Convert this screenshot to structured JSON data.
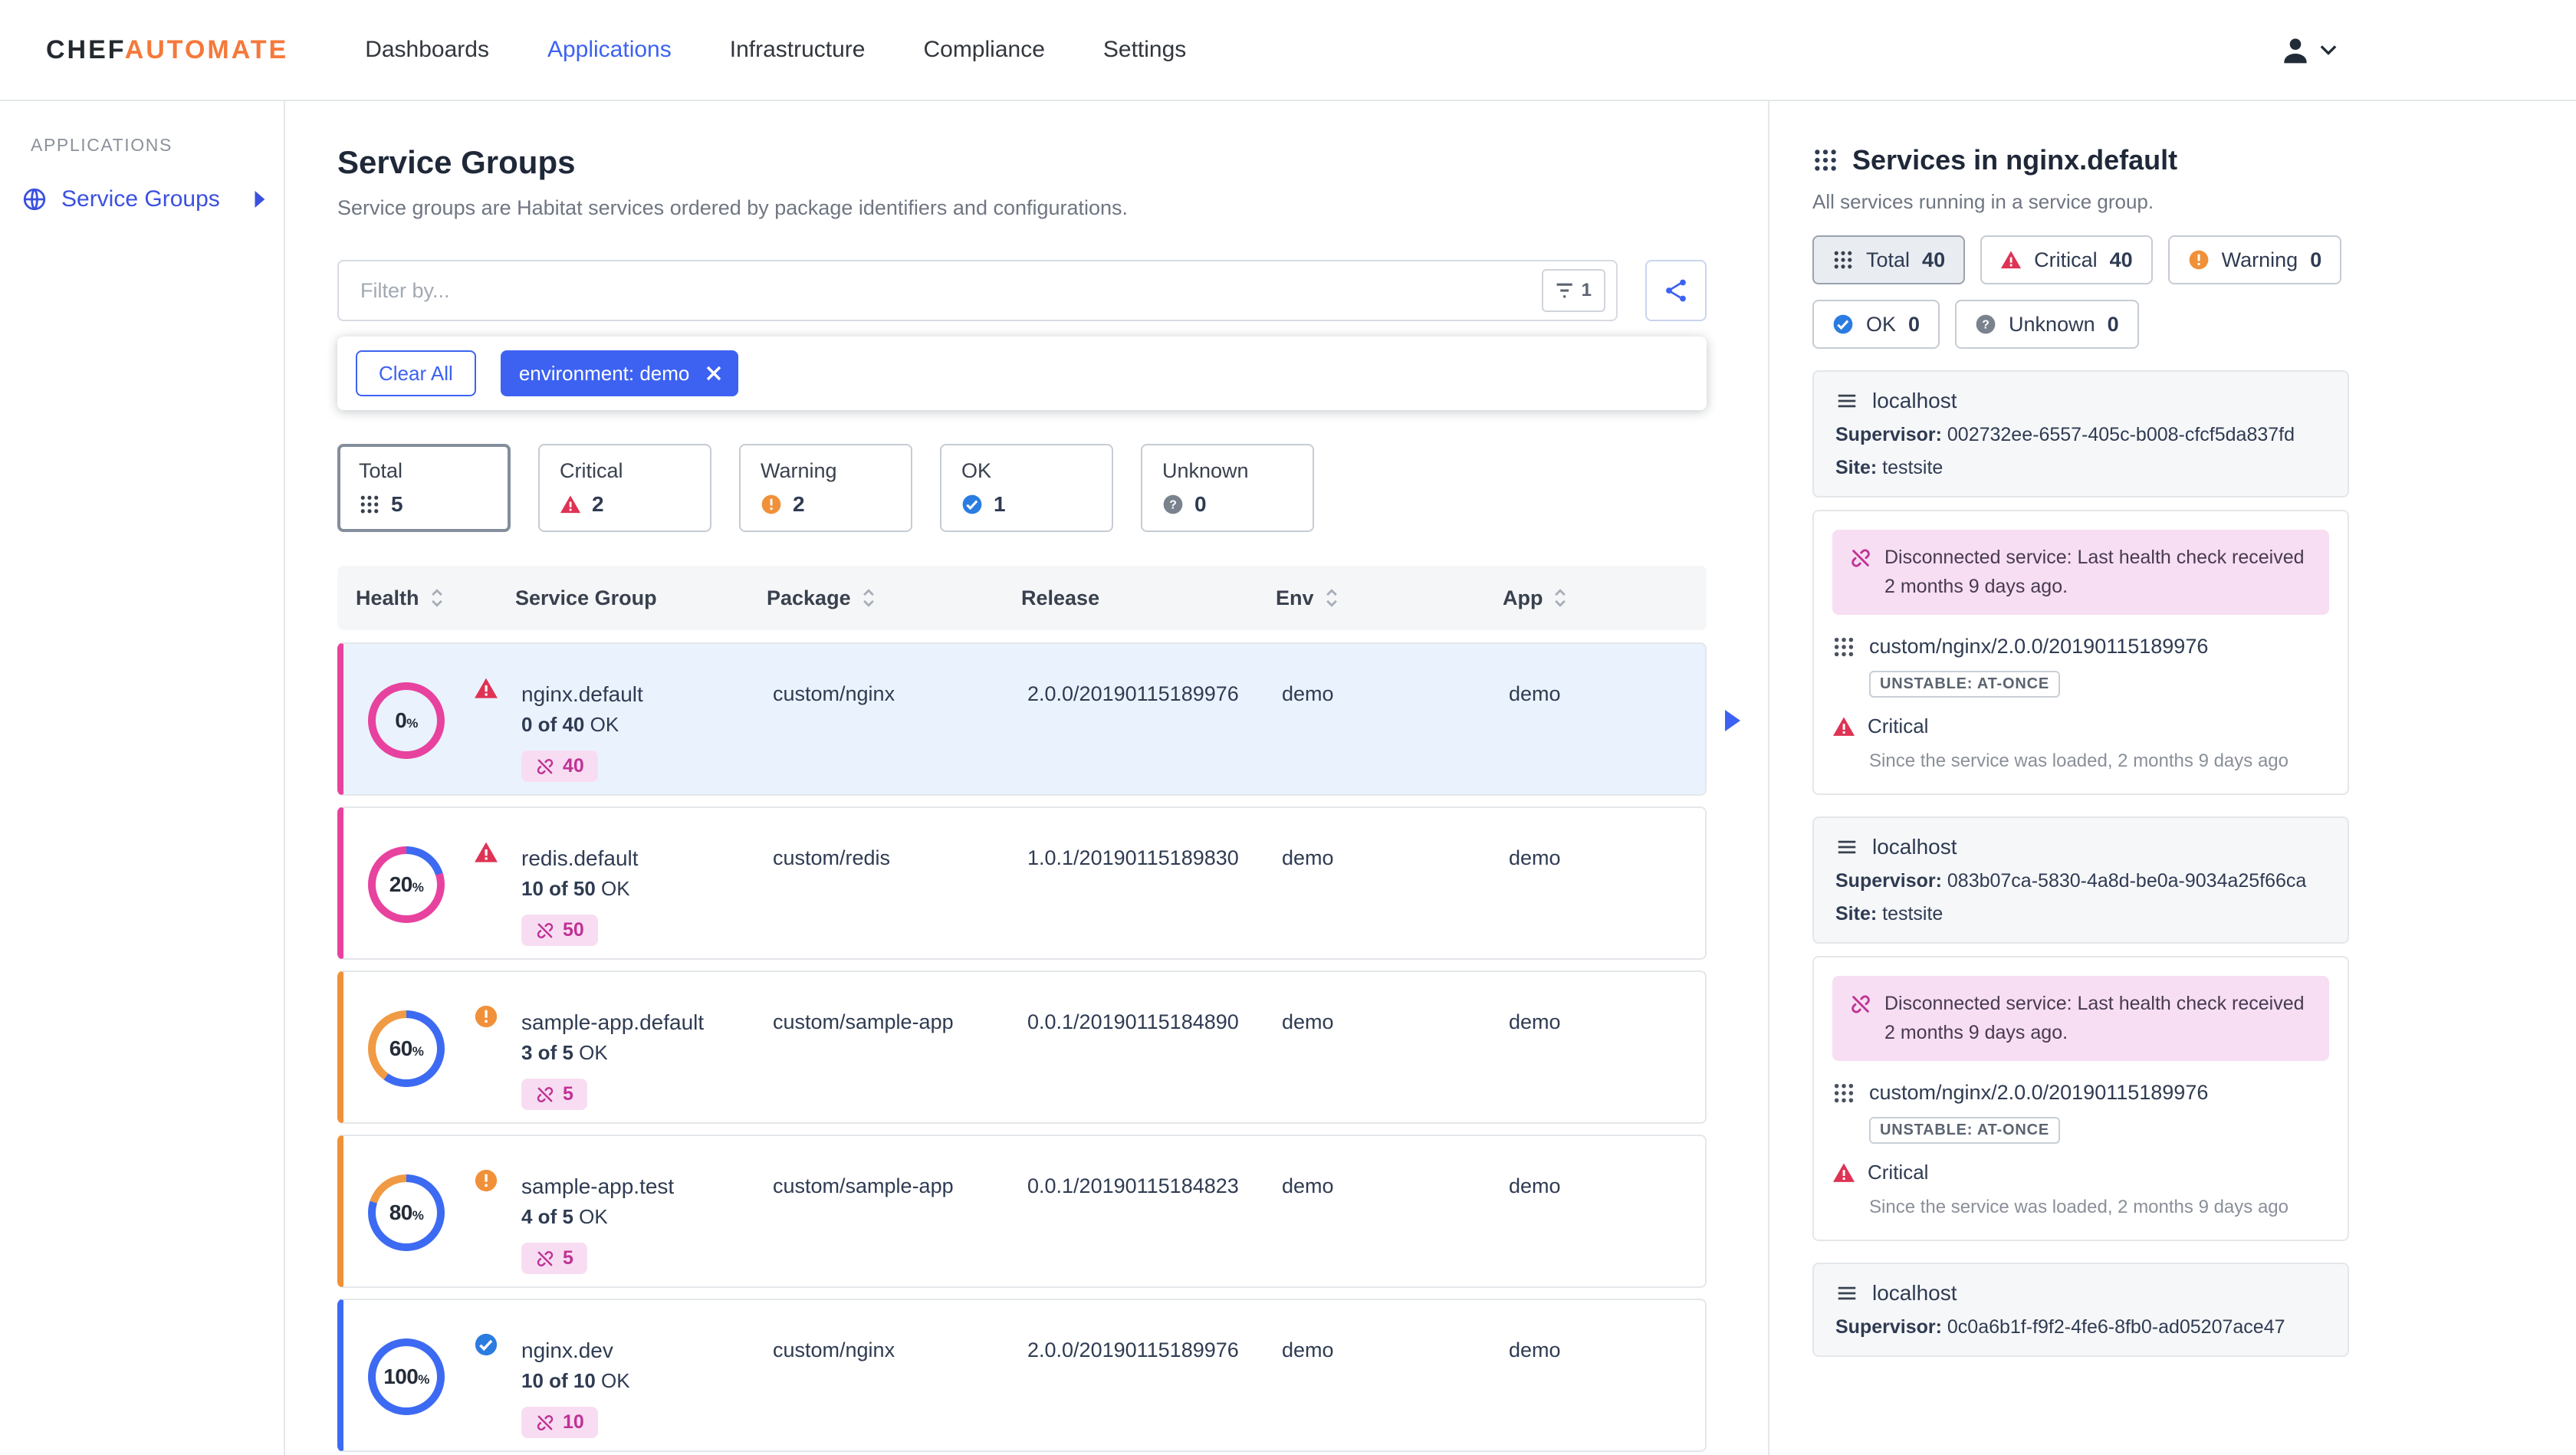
{
  "colors": {
    "accent_blue": "#3d62f2",
    "brand_orange": "#f5793b",
    "critical_red": "#de3354",
    "warning_orange": "#f0913a",
    "ok_blue": "#2b7ce0",
    "unknown_gray": "#7a828e",
    "magenta": "#bf3295",
    "donut_blue": "#3d6af2",
    "donut_pink": "#e8429f",
    "donut_orange": "#f09a43",
    "row_selected_bg": "#eaf3fd",
    "dark_icon": "#39414e"
  },
  "brand": {
    "chef": "CHEF",
    "automate": "AUTOMATE"
  },
  "nav": {
    "items": [
      {
        "label": "Dashboards",
        "active": false
      },
      {
        "label": "Applications",
        "active": true
      },
      {
        "label": "Infrastructure",
        "active": false
      },
      {
        "label": "Compliance",
        "active": false
      },
      {
        "label": "Settings",
        "active": false
      }
    ]
  },
  "sidebar": {
    "heading": "APPLICATIONS",
    "items": [
      {
        "label": "Service Groups"
      }
    ]
  },
  "main": {
    "title": "Service Groups",
    "subtitle": "Service groups are Habitat services ordered by package identifiers and configurations.",
    "filter": {
      "placeholder": "Filter by...",
      "filter_count": "1",
      "clear_all_label": "Clear All",
      "chips": [
        {
          "label": "environment: demo"
        }
      ]
    },
    "status_cards": [
      {
        "label": "Total",
        "count": "5",
        "status": "total",
        "selected": true
      },
      {
        "label": "Critical",
        "count": "2",
        "status": "critical",
        "selected": false
      },
      {
        "label": "Warning",
        "count": "2",
        "status": "warning",
        "selected": false
      },
      {
        "label": "OK",
        "count": "1",
        "status": "ok",
        "selected": false
      },
      {
        "label": "Unknown",
        "count": "0",
        "status": "unknown",
        "selected": false
      }
    ],
    "table": {
      "columns": [
        {
          "label": "Health",
          "sortable": true
        },
        {
          "label": "Service Group",
          "sortable": false
        },
        {
          "label": "Package",
          "sortable": true
        },
        {
          "label": "Release",
          "sortable": false
        },
        {
          "label": "Env",
          "sortable": true
        },
        {
          "label": "App",
          "sortable": true
        }
      ],
      "rows": [
        {
          "percent": 0,
          "status": "critical",
          "name": "nginx.default",
          "ok_count": "0 of 40",
          "ok_suffix": "OK",
          "disconnected_count": "40",
          "package": "custom/nginx",
          "release": "2.0.0/20190115189976",
          "env": "demo",
          "app": "demo",
          "selected": true
        },
        {
          "percent": 20,
          "status": "critical",
          "name": "redis.default",
          "ok_count": "10 of 50",
          "ok_suffix": "OK",
          "disconnected_count": "50",
          "package": "custom/redis",
          "release": "1.0.1/20190115189830",
          "env": "demo",
          "app": "demo",
          "selected": false
        },
        {
          "percent": 60,
          "status": "warning",
          "name": "sample-app.default",
          "ok_count": "3 of 5",
          "ok_suffix": "OK",
          "disconnected_count": "5",
          "package": "custom/sample-app",
          "release": "0.0.1/20190115184890",
          "env": "demo",
          "app": "demo",
          "selected": false
        },
        {
          "percent": 80,
          "status": "warning",
          "name": "sample-app.test",
          "ok_count": "4 of 5",
          "ok_suffix": "OK",
          "disconnected_count": "5",
          "package": "custom/sample-app",
          "release": "0.0.1/20190115184823",
          "env": "demo",
          "app": "demo",
          "selected": false
        },
        {
          "percent": 100,
          "status": "ok",
          "name": "nginx.dev",
          "ok_count": "10 of 10",
          "ok_suffix": "OK",
          "disconnected_count": "10",
          "package": "custom/nginx",
          "release": "2.0.0/20190115189976",
          "env": "demo",
          "app": "demo",
          "selected": false
        }
      ]
    }
  },
  "panel": {
    "title": "Services in nginx.default",
    "subtitle": "All services running in a service group.",
    "filters": [
      {
        "label": "Total",
        "count": "40",
        "status": "total",
        "selected": true
      },
      {
        "label": "Critical",
        "count": "40",
        "status": "critical",
        "selected": false
      },
      {
        "label": "Warning",
        "count": "0",
        "status": "warning",
        "selected": false
      },
      {
        "label": "OK",
        "count": "0",
        "status": "ok",
        "selected": false
      },
      {
        "label": "Unknown",
        "count": "0",
        "status": "unknown",
        "selected": false
      }
    ],
    "groups": [
      {
        "host": "localhost",
        "supervisor_label": "Supervisor:",
        "supervisor_id": "002732ee-6557-405c-b008-cfcf5da837fd",
        "site_label": "Site:",
        "site": "testsite",
        "service": {
          "alert": "Disconnected service: Last health check received 2 months 9 days ago.",
          "package": "custom/nginx/2.0.0/20190115189976",
          "update_strategy": "UNSTABLE: AT-ONCE",
          "health": "Critical",
          "health_status": "critical",
          "since": "Since the service was loaded, 2 months 9 days ago"
        }
      },
      {
        "host": "localhost",
        "supervisor_label": "Supervisor:",
        "supervisor_id": "083b07ca-5830-4a8d-be0a-9034a25f66ca",
        "site_label": "Site:",
        "site": "testsite",
        "service": {
          "alert": "Disconnected service: Last health check received 2 months 9 days ago.",
          "package": "custom/nginx/2.0.0/20190115189976",
          "update_strategy": "UNSTABLE: AT-ONCE",
          "health": "Critical",
          "health_status": "critical",
          "since": "Since the service was loaded, 2 months 9 days ago"
        }
      },
      {
        "host": "localhost",
        "supervisor_label": "Supervisor:",
        "supervisor_id": "0c0a6b1f-f9f2-4fe6-8fb0-ad05207ace47"
      }
    ]
  }
}
